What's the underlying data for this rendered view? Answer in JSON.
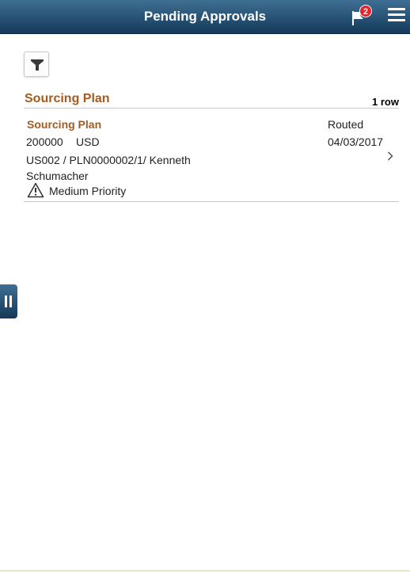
{
  "header": {
    "title": "Pending Approvals",
    "notification_count": "2",
    "flag_icon": "flag-icon",
    "menu_icon": "hamburger-menu-icon"
  },
  "toolbar": {
    "filter_icon": "filter-icon"
  },
  "section": {
    "title": "Sourcing Plan",
    "row_count": "1 row"
  },
  "items": [
    {
      "title": "Sourcing Plan",
      "amount": "200000",
      "currency": "USD",
      "description": "US002 / PLN0000002/1/ Kenneth Schumacher",
      "priority": "Medium Priority",
      "priority_icon": "warning-icon",
      "status": "Routed",
      "date": "04/03/2017"
    }
  ],
  "colors": {
    "header_top": "#3e6f93",
    "header_bottom": "#15395a",
    "accent": "#a65a1e",
    "badge": "#e3222a"
  }
}
